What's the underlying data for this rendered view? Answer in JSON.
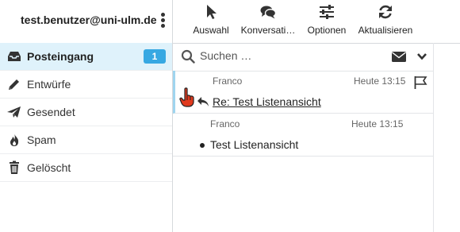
{
  "account": {
    "email": "test.benutzer@uni-ulm.de",
    "menu_icon": "kebab-icon"
  },
  "folders": [
    {
      "label": "Posteingang",
      "icon": "inbox-icon",
      "badge": "1",
      "active": true
    },
    {
      "label": "Entwürfe",
      "icon": "pencil-icon"
    },
    {
      "label": "Gesendet",
      "icon": "paper-plane-icon"
    },
    {
      "label": "Spam",
      "icon": "fire-icon"
    },
    {
      "label": "Gelöscht",
      "icon": "trash-icon"
    }
  ],
  "toolbar": [
    {
      "label": "Auswahl",
      "icon": "cursor-icon"
    },
    {
      "label": "Konversati…",
      "icon": "chat-bubbles-icon"
    },
    {
      "label": "Optionen",
      "icon": "sliders-icon"
    },
    {
      "label": "Aktualisieren",
      "icon": "refresh-icon"
    }
  ],
  "search": {
    "placeholder": "Suchen …",
    "icon": "search-icon",
    "mail_icon": "envelope-icon",
    "dropdown_icon": "chevron-down-icon"
  },
  "messages": [
    {
      "from": "Franco",
      "date": "Heute 13:15",
      "subject": "Re: Test Listenansicht",
      "status_icons": [
        "hand-pointer-icon",
        "reply-icon"
      ],
      "flag_icon": "flag-icon",
      "selected": true
    },
    {
      "from": "Franco",
      "date": "Heute 13:15",
      "subject": "Test Listenansicht",
      "status_icons": [
        "unread-dot-icon"
      ]
    }
  ],
  "colors": {
    "accent": "#37a8e2",
    "active_background": "#dff2fb",
    "selection_border": "#9fd5ef",
    "cursor_hand": "#e03a1e"
  }
}
